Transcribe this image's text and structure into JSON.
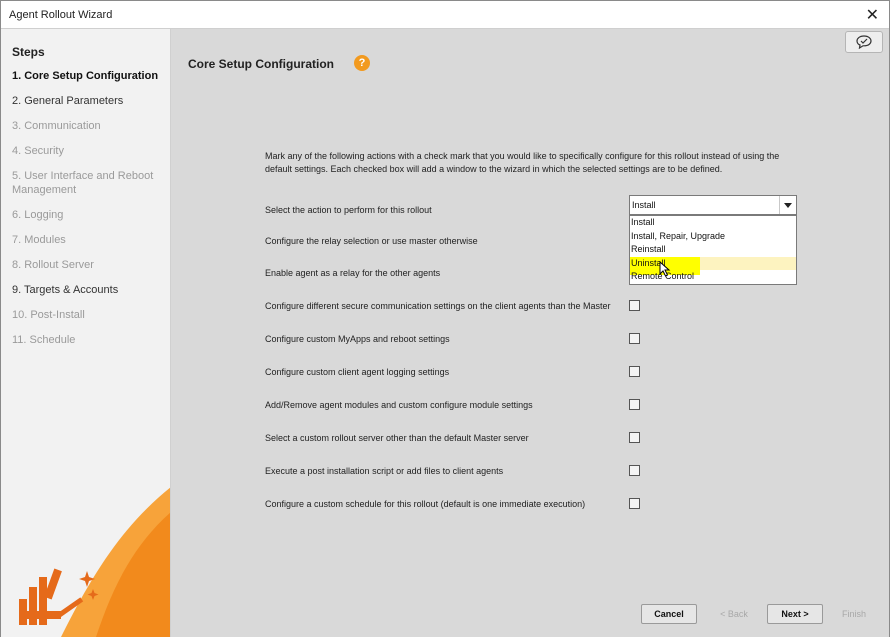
{
  "window": {
    "title": "Agent Rollout Wizard",
    "close": "✕"
  },
  "sidebar": {
    "heading": "Steps",
    "steps": [
      {
        "label": "1. Core Setup Configuration",
        "state": "active"
      },
      {
        "label": "2. General Parameters",
        "state": "done"
      },
      {
        "label": "3. Communication",
        "state": "disabled"
      },
      {
        "label": "4. Security",
        "state": "disabled"
      },
      {
        "label": "5. User Interface and Reboot Management",
        "state": "disabled"
      },
      {
        "label": "6. Logging",
        "state": "disabled"
      },
      {
        "label": "7. Modules",
        "state": "disabled"
      },
      {
        "label": "8. Rollout Server",
        "state": "disabled"
      },
      {
        "label": "9. Targets & Accounts",
        "state": "done"
      },
      {
        "label": "10. Post-Install",
        "state": "disabled"
      },
      {
        "label": "11. Schedule",
        "state": "disabled"
      }
    ]
  },
  "main": {
    "title": "Core Setup Configuration",
    "help": "?",
    "intro": "Mark any of the following actions with a check mark that you would like to specifically configure for this rollout instead of using the default settings. Each checked box will add a window to the wizard in which the selected settings are to be defined.",
    "action_label": "Select the action to perform for this rollout",
    "action_value": "Install",
    "action_options": [
      "Install",
      "Install, Repair, Upgrade",
      "Reinstall",
      "Uninstall",
      "Remote Control"
    ],
    "hovered_option": "Uninstall",
    "options": [
      {
        "label": "Configure the relay selection or use master otherwise"
      },
      {
        "label": "Enable agent as a relay for the other agents"
      },
      {
        "label": "Configure different secure communication settings on the client agents than the Master"
      },
      {
        "label": "Configure custom MyApps and reboot settings"
      },
      {
        "label": "Configure custom client agent logging settings"
      },
      {
        "label": "Add/Remove agent modules and custom configure module settings"
      },
      {
        "label": "Select a custom rollout server other than the default Master server"
      },
      {
        "label": "Execute a post installation script or add files to client agents"
      },
      {
        "label": "Configure a custom schedule for this rollout (default is one immediate execution)"
      }
    ]
  },
  "footer": {
    "cancel": "Cancel",
    "back": "< Back",
    "next": "Next >",
    "finish": "Finish"
  },
  "colors": {
    "accent": "#f29a1f",
    "highlight": "#ffff00",
    "hover_row": "#fdf3c0"
  }
}
